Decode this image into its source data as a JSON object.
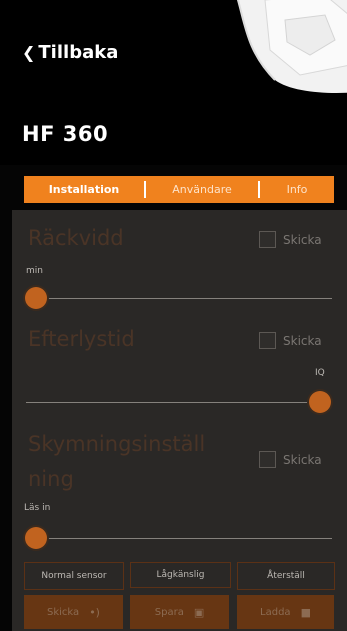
{
  "header": {
    "back_label": "Tillbaka",
    "title": "HF 360"
  },
  "tabs": [
    {
      "label": "Installation",
      "active": true
    },
    {
      "label": "Användare",
      "active": false
    },
    {
      "label": "Info",
      "active": false
    }
  ],
  "sections": {
    "range": {
      "title": "Räckvidd",
      "checkbox_label": "Skicka",
      "checked": false,
      "slider_label": "min",
      "slider_value": 0
    },
    "afterglow": {
      "title": "Efterlystid",
      "checkbox_label": "Skicka",
      "checked": false,
      "slider_label": "IQ",
      "slider_value": 1
    },
    "twilight": {
      "title_line1": "Skymningsinställ",
      "title_line2": "ning",
      "checkbox_label": "Skicka",
      "checked": false,
      "slider_label": "Läs in",
      "slider_value": 0
    }
  },
  "buttons": {
    "normal_sensor": "Normal sensor",
    "low_sensitive": "Lågkänslig",
    "reset": "Återställ",
    "send": "Skicka",
    "save": "Spara",
    "load": "Ladda"
  },
  "icons": {
    "back": "chevron-left-icon",
    "send": "wireless-signal-icon",
    "save": "floppy-disk-icon",
    "load": "folder-icon"
  },
  "colors": {
    "accent": "#f0821e",
    "slider_thumb": "#c1631f",
    "panel": "#2a2826",
    "bottom_button": "#673613"
  }
}
